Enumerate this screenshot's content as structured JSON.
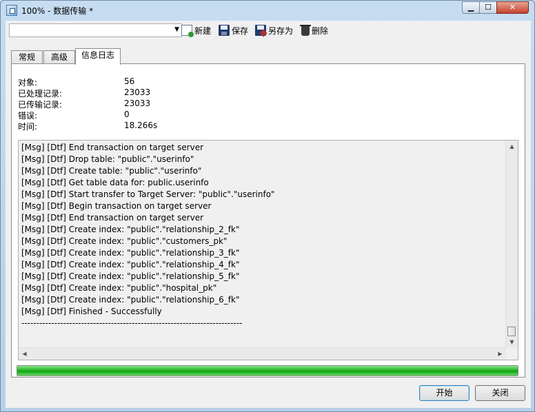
{
  "window": {
    "title": "100% - 数据传输 *",
    "min_label": "▁",
    "max_label": "☐",
    "close_label": "✕"
  },
  "toolbar": {
    "combo_value": "",
    "new_label": "新建",
    "save_label": "保存",
    "save_as_label": "另存为",
    "delete_label": "删除"
  },
  "tabs": [
    {
      "label": "常规"
    },
    {
      "label": "高级"
    },
    {
      "label": "信息日志"
    }
  ],
  "stats": [
    {
      "label": "对象:",
      "value": "56"
    },
    {
      "label": "已处理记录:",
      "value": "23033"
    },
    {
      "label": "已传输记录:",
      "value": "23033"
    },
    {
      "label": "错误:",
      "value": "0"
    },
    {
      "label": "时间:",
      "value": "18.266s"
    }
  ],
  "log": [
    "[Msg] [Dtf] End transaction on target server",
    "[Msg] [Dtf] Drop table: \"public\".\"userinfo\"",
    "[Msg] [Dtf] Create table: \"public\".\"userinfo\"",
    "[Msg] [Dtf] Get table data for: public.userinfo",
    "[Msg] [Dtf] Start transfer to Target Server: \"public\".\"userinfo\"",
    "[Msg] [Dtf] Begin transaction on target server",
    "[Msg] [Dtf] End transaction on target server",
    "[Msg] [Dtf] Create index: \"public\".\"relationship_2_fk\"",
    "[Msg] [Dtf] Create index: \"public\".\"customers_pk\"",
    "[Msg] [Dtf] Create index: \"public\".\"relationship_3_fk\"",
    "[Msg] [Dtf] Create index: \"public\".\"relationship_4_fk\"",
    "[Msg] [Dtf] Create index: \"public\".\"relationship_5_fk\"",
    "[Msg] [Dtf] Create index: \"public\".\"hospital_pk\"",
    "[Msg] [Dtf] Create index: \"public\".\"relationship_6_fk\"",
    "[Msg] [Dtf] Finished - Successfully",
    "--------------------------------------------------------------------------"
  ],
  "progress": {
    "value": 1.0,
    "color": "#25b525"
  },
  "buttons": {
    "start_label": "开始",
    "close_label": "关闭"
  }
}
